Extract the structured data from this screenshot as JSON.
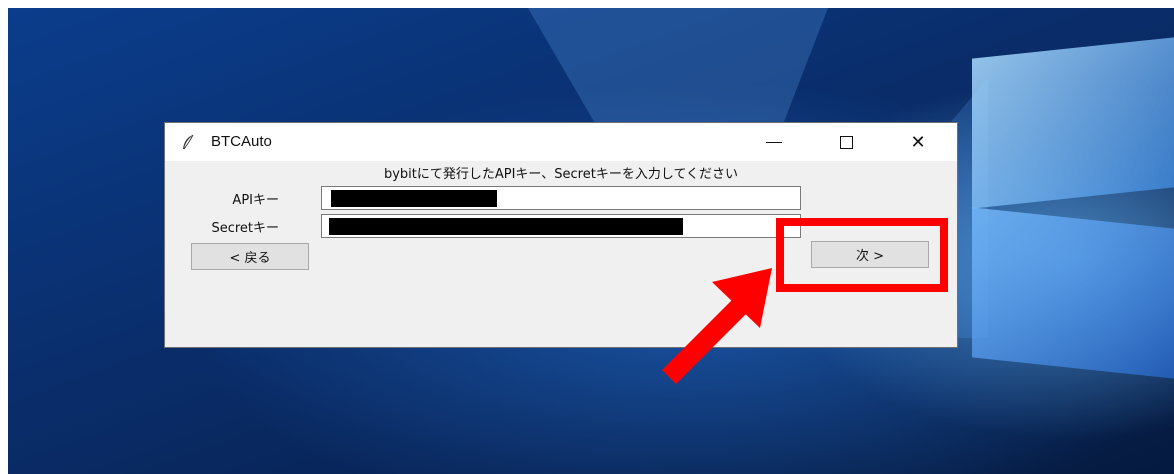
{
  "app": {
    "title": "BTCAuto",
    "icon": "feather-icon"
  },
  "window_controls": {
    "minimize": "—",
    "maximize": "☐",
    "close": "✕"
  },
  "dialog": {
    "instruction": "bybitにて発行したAPIキー、Secretキーを入力してください",
    "api_label": "APIキー",
    "secret_label": "Secretキー",
    "api_value": "",
    "secret_value": "",
    "back_label": "< 戻る",
    "next_label": "次 >"
  },
  "colors": {
    "highlight": "#ff0000",
    "arrow": "#ff0000"
  }
}
